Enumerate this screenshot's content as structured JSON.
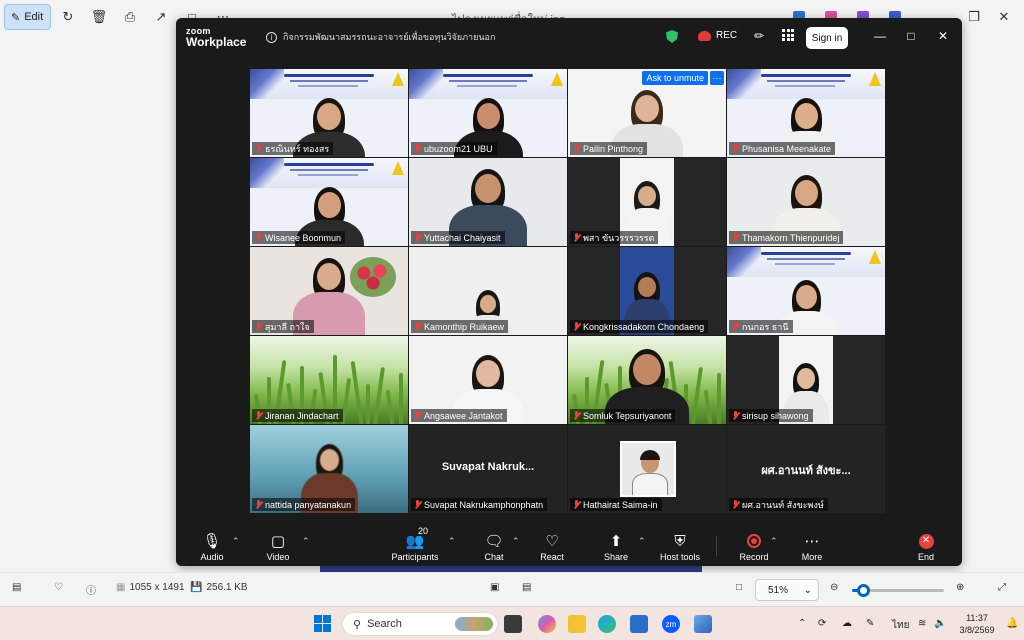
{
  "viewer": {
    "edit_label": "Edit",
    "file_name": "ไปลงเผยแพร่ชื่อใหม่.jpg",
    "dimensions": "1055 x 1491",
    "file_size": "256.1 KB",
    "zoom_level": "51%",
    "zoom_fraction": 0.12
  },
  "zoom": {
    "logo_top": "zoom",
    "logo_bottom": "Workplace",
    "meeting_title": "กิจกรรมพัฒนาสมรรถนะอาจารย์เพื่อขอทุนวิจัยภายนอก",
    "rec_label": "REC",
    "sign_in": "Sign in",
    "ask_unmute": "Ask to unmute",
    "tile_more": "···",
    "participants_count": "20",
    "participants": [
      {
        "name": "ธรณินทร์ ทองสร"
      },
      {
        "name": "ubuzoom21 UBU"
      },
      {
        "name": "Pailin Pinthong"
      },
      {
        "name": "Phusanisa Meenakate"
      },
      {
        "name": "Wisanee Boonmun"
      },
      {
        "name": "Yuttachai Chaiyasit"
      },
      {
        "name": "พสา ขันวรรรวรรต"
      },
      {
        "name": "Thamakorn Thienpuridej"
      },
      {
        "name": "สุมาลี ถาใจ"
      },
      {
        "name": "Kamonthip Ruikaew"
      },
      {
        "name": "Kongkrissadakorn Chondaeng"
      },
      {
        "name": "กนกอร ธานี"
      },
      {
        "name": "Jiranan Jindachart"
      },
      {
        "name": "Angsawee Jantakot"
      },
      {
        "name": "Somluk Tepsuriyanont"
      },
      {
        "name": "sirisup sihawong"
      },
      {
        "name": "nattida panyatanakun"
      },
      {
        "name": "Suvapat Nakrukamphonphatn",
        "display": "Suvapat  Nakruk..."
      },
      {
        "name": "Hathairat Saima-in"
      },
      {
        "name": "ผศ.อานนท์ สังขะพงษ์",
        "display": "ผศ.อานนท์ สังขะ..."
      }
    ],
    "controls": {
      "audio": "Audio",
      "video": "Video",
      "participants": "Participants",
      "chat": "Chat",
      "react": "React",
      "share": "Share",
      "host_tools": "Host tools",
      "record": "Record",
      "more": "More",
      "end": "End"
    }
  },
  "taskbar": {
    "search_label": "Search",
    "language": "ไทย",
    "time": "11:37",
    "date": "3/8/2569"
  },
  "colors": {
    "zoom_bg": "#1a1a1a",
    "active_speaker": "#2fd17a",
    "muted_red": "#e8423f",
    "zoom_blue": "#0e71eb",
    "windows_accent": "#0067c0"
  }
}
